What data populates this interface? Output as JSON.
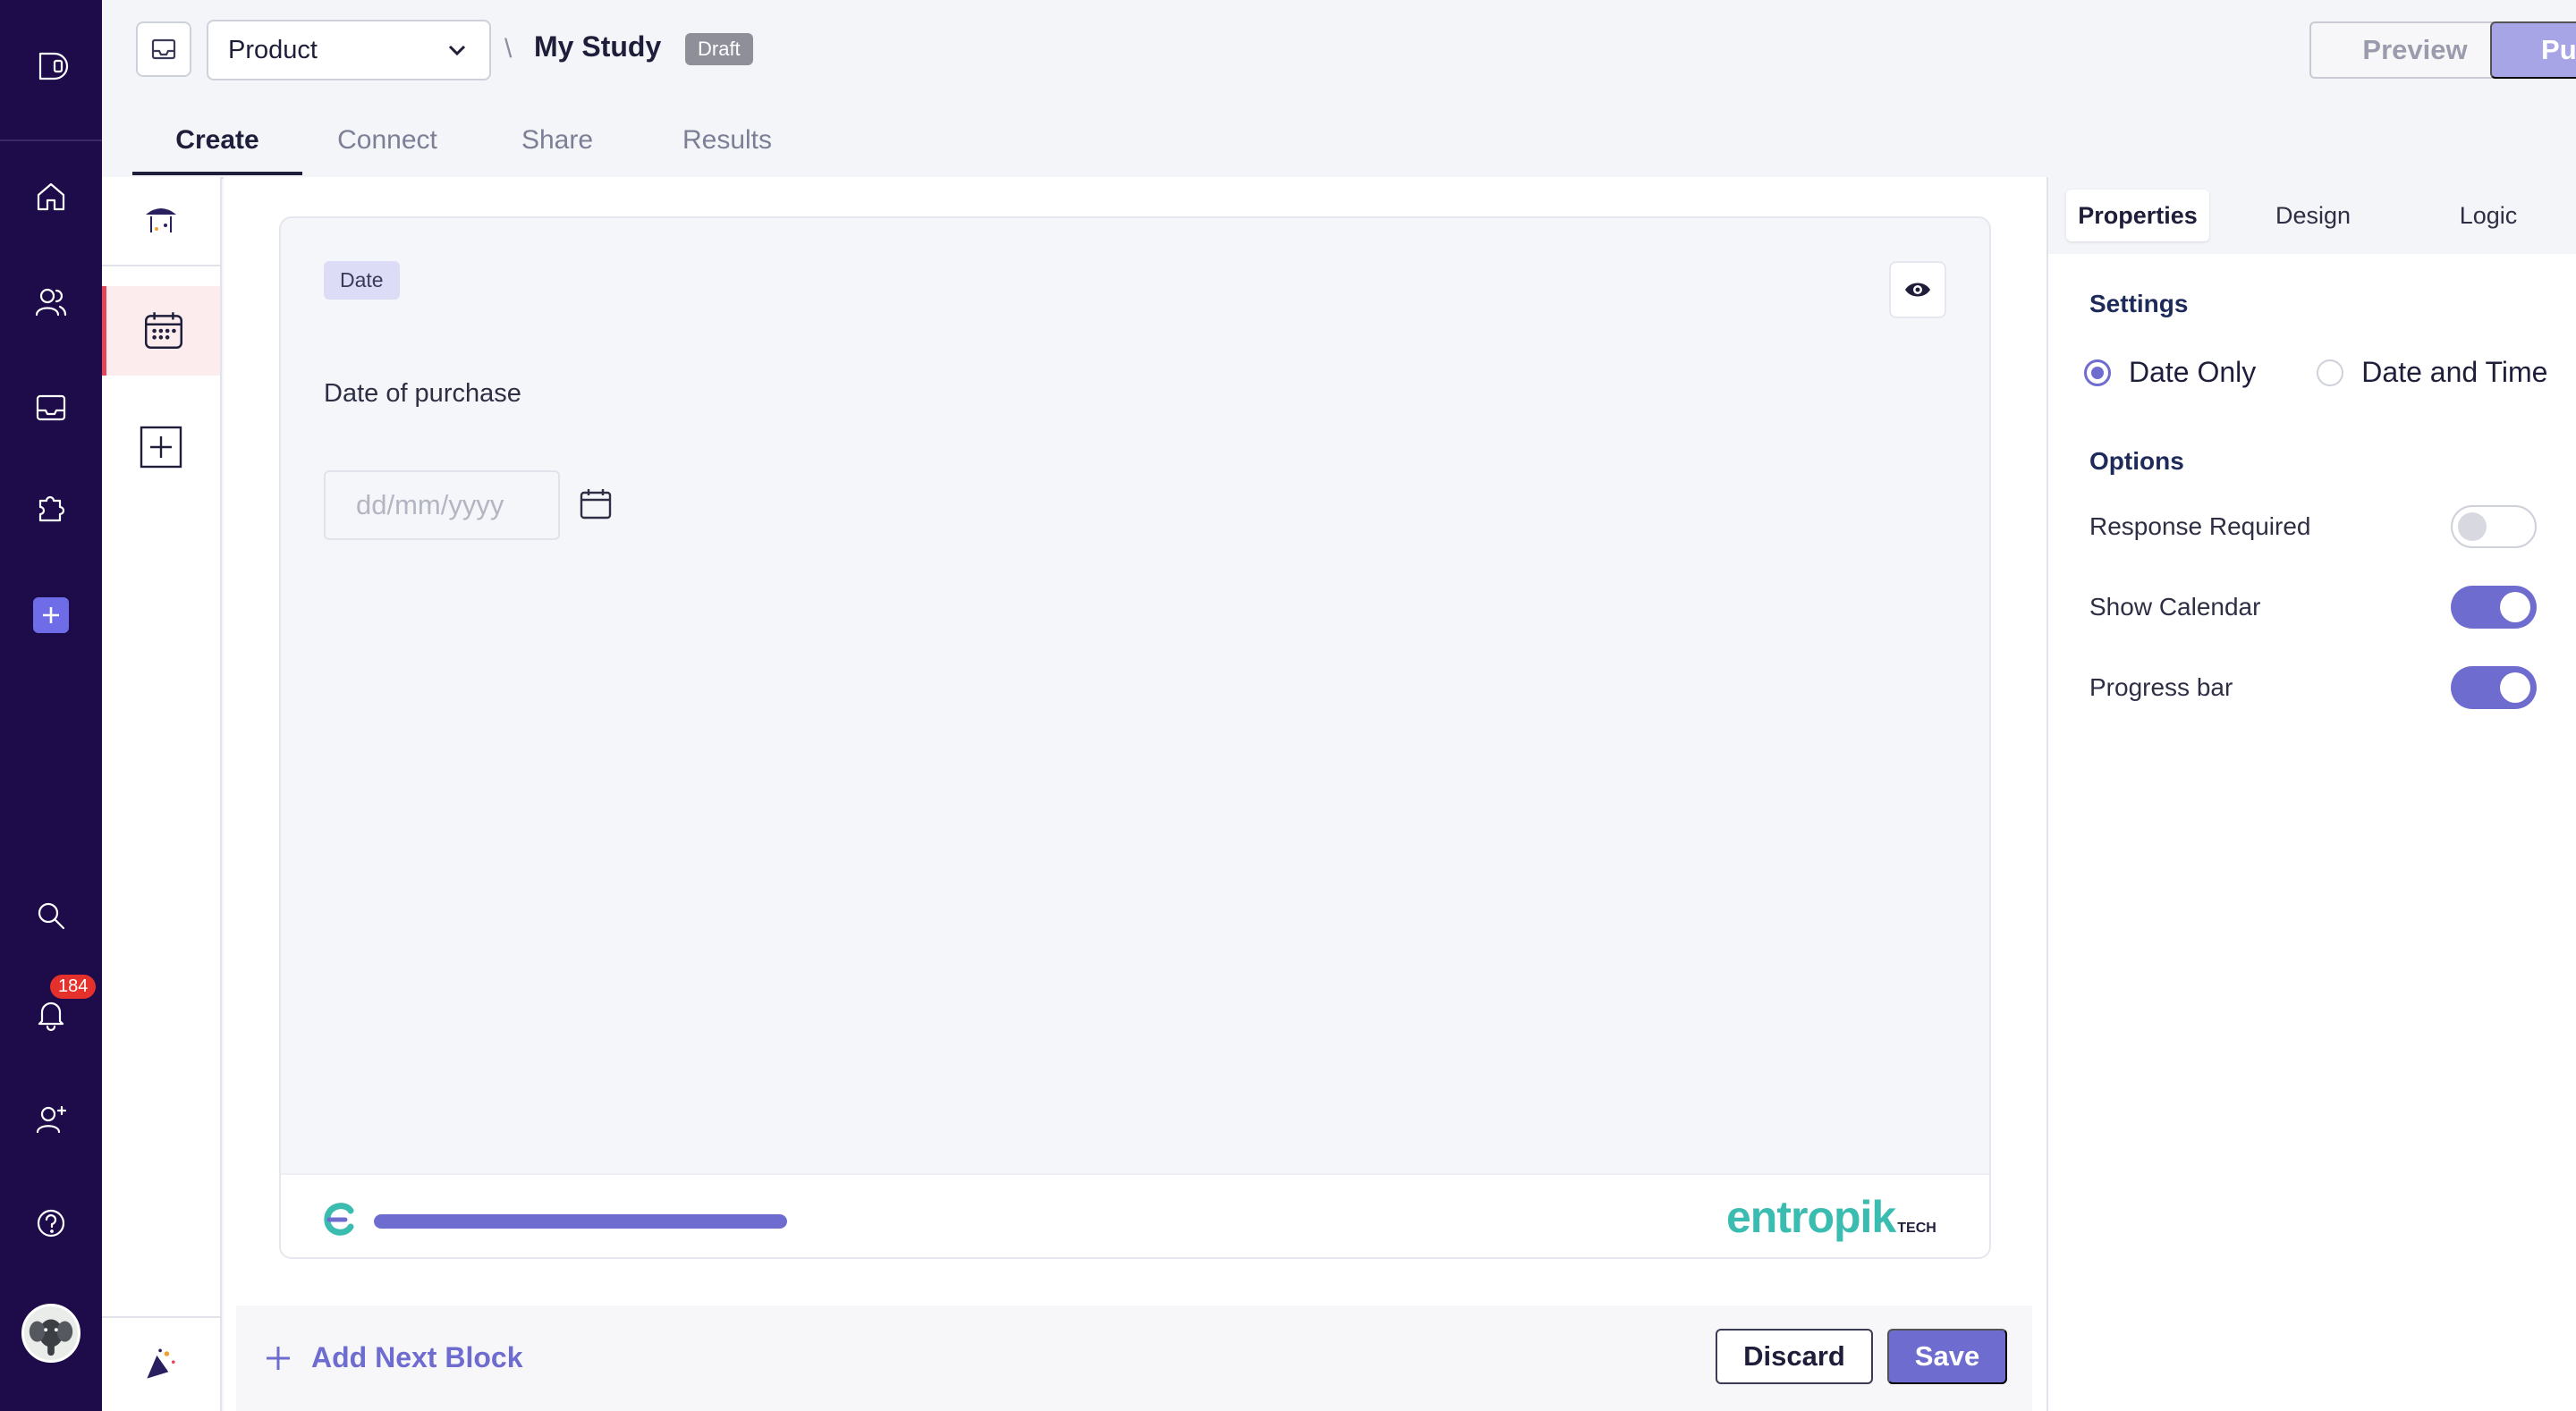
{
  "header": {
    "product_select": "Product",
    "separator": "\\",
    "study_title": "My Study",
    "status_badge": "Draft",
    "preview_label": "Preview",
    "publish_label": "Publish"
  },
  "tabs": [
    {
      "label": "Create",
      "active": true
    },
    {
      "label": "Connect",
      "active": false
    },
    {
      "label": "Share",
      "active": false
    },
    {
      "label": "Results",
      "active": false
    }
  ],
  "rail": {
    "icons": [
      "logo-icon",
      "home-icon",
      "users-icon",
      "inbox-icon",
      "puzzle-icon",
      "add-icon",
      "search-icon",
      "bell-icon",
      "add-user-icon",
      "help-icon"
    ],
    "notification_count": "184"
  },
  "block": {
    "type_tag": "Date",
    "question": "Date of purchase",
    "date_placeholder": "dd/mm/yyyy",
    "progress_fraction": 1.0,
    "brand_name": "entropik",
    "brand_suffix": "TECH"
  },
  "bottom": {
    "add_next_label": "Add Next Block",
    "discard_label": "Discard",
    "save_label": "Save"
  },
  "right_panel": {
    "tabs": [
      "Properties",
      "Design",
      "Logic"
    ],
    "active_tab": "Properties",
    "settings_title": "Settings",
    "date_options": [
      {
        "label": "Date Only",
        "selected": true
      },
      {
        "label": "Date and Time",
        "selected": false
      }
    ],
    "options_title": "Options",
    "options": [
      {
        "label": "Response Required",
        "enabled": false
      },
      {
        "label": "Show Calendar",
        "enabled": true
      },
      {
        "label": "Progress bar",
        "enabled": true
      }
    ]
  },
  "colors": {
    "rail_bg": "#1d0b4a",
    "accent": "#6f6ccf",
    "brand": "#3bbcb0",
    "badge_red": "#e5312c"
  }
}
